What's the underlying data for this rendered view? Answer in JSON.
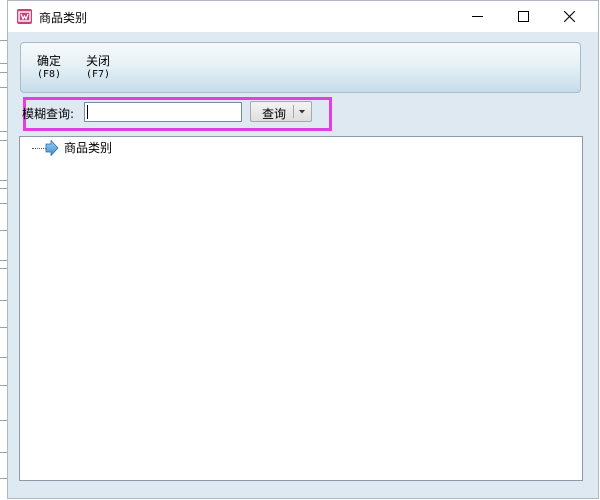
{
  "window": {
    "title": "商品类别"
  },
  "toolbar": {
    "confirm": {
      "label": "确定",
      "key": "(F8)"
    },
    "close": {
      "label": "关闭",
      "key": "(F7)"
    }
  },
  "search": {
    "label": "模糊查询:",
    "value": "",
    "button": "查询"
  },
  "tree": {
    "items": [
      {
        "label": "商品类别"
      }
    ]
  },
  "colors": {
    "highlight": "#e040e0",
    "app_icon": "#c8407a",
    "window_bg": "#dfe9f1"
  }
}
